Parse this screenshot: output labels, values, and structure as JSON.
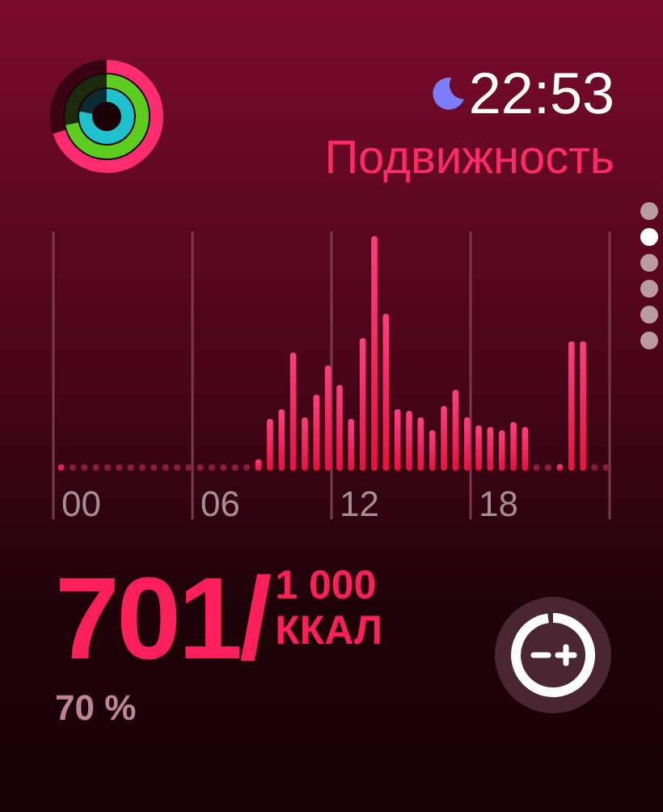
{
  "rings": [
    {
      "kind": "move",
      "color": "#ff2d6f",
      "level": 0.7
    },
    {
      "kind": "exercise",
      "color": "#5ccc1e",
      "level": 0.72
    },
    {
      "kind": "stand",
      "color": "#1fc1cc",
      "level": 0.78
    }
  ],
  "time": "22:53",
  "title": "Подвижность",
  "chart": {
    "hour_labels": [
      "00",
      "06",
      "12",
      "18"
    ]
  },
  "page_dots": [
    {
      "selected": false
    },
    {
      "selected": true
    },
    {
      "selected": false
    },
    {
      "selected": false
    },
    {
      "selected": false
    },
    {
      "selected": false
    }
  ],
  "calories": {
    "value": "701/",
    "goal": "1 000",
    "unit": "ККАЛ",
    "percent": "70 %"
  }
}
